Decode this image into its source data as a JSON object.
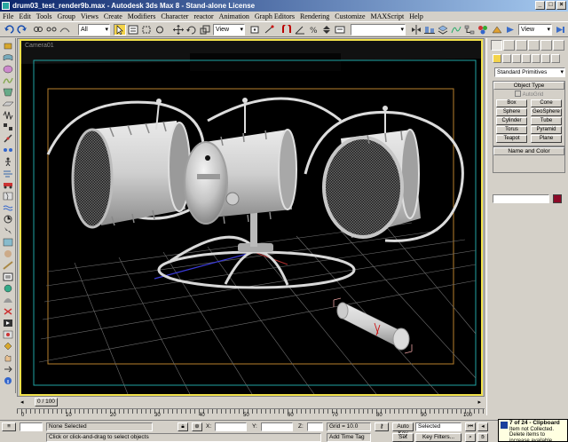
{
  "window": {
    "title": "drum03_test_render9b.max - Autodesk 3ds Max 8 - Stand-alone License",
    "minimize": "_",
    "maximize": "□",
    "close": "×"
  },
  "menu": [
    "File",
    "Edit",
    "Tools",
    "Group",
    "Views",
    "Create",
    "Modifiers",
    "Character",
    "reactor",
    "Animation",
    "Graph Editors",
    "Rendering",
    "Customize",
    "MAXScript",
    "Help"
  ],
  "toolbar": {
    "selection_filter": "All",
    "ref_coord": "View",
    "named_selection": "",
    "view_dropdown_right": "View"
  },
  "viewport": {
    "label": "Camera01"
  },
  "command_panel": {
    "category": "Standard Primitives",
    "object_type_title": "Object Type",
    "autogrid": "AutoGrid",
    "primitives": [
      "Box",
      "Cone",
      "Sphere",
      "GeoSphere",
      "Cylinder",
      "Tube",
      "Torus",
      "Pyramid",
      "Teapot",
      "Plane"
    ],
    "name_color_title": "Name and Color",
    "object_name": "",
    "object_color": "#8c0a28"
  },
  "timeline": {
    "frame_display": "0 / 100",
    "ticks": [
      "0",
      "10",
      "20",
      "30",
      "40",
      "50",
      "60",
      "70",
      "80",
      "90",
      "100"
    ]
  },
  "status": {
    "selection": "None Selected",
    "prompt": "Click or click-and-drag to select objects",
    "x_label": "X:",
    "y_label": "Y:",
    "z_label": "Z:",
    "grid": "Grid = 10.0",
    "add_time_tag": "Add Time Tag",
    "auto_key": "Auto Key",
    "set_key": "Set Key",
    "key_mode": "Selected",
    "key_filters": "Key Filters..."
  },
  "notification": {
    "title": "7 of 24 - Clipboard",
    "body": "Item not Collected. Delete items to increase available space"
  },
  "colors": {
    "viewport_border": "#f2e24b",
    "safe_frame_outer": "#1fa5a5",
    "safe_frame_inner": "#b8802c",
    "grid": "#6e6e6e"
  }
}
